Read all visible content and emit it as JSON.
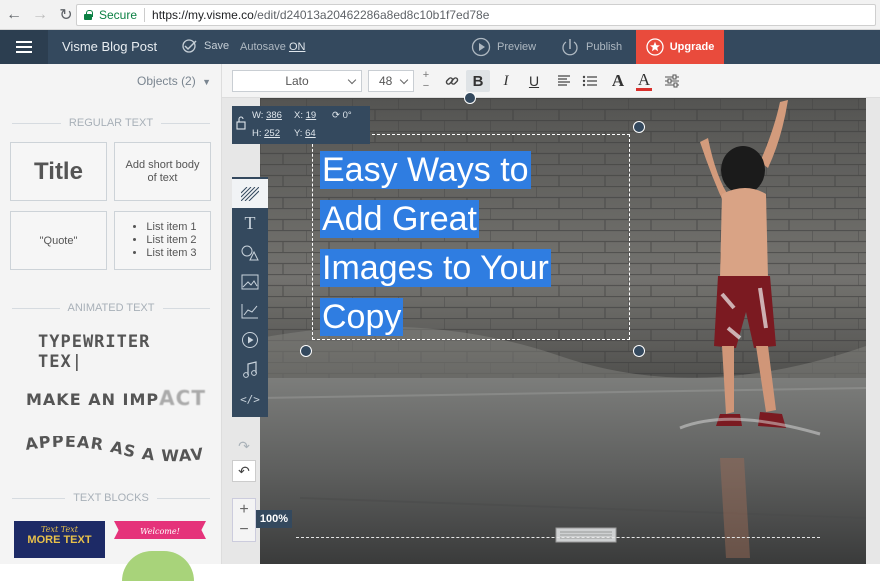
{
  "browser": {
    "secure_label": "Secure",
    "url_host": "https://my.visme.co",
    "url_path": "/edit/d24013a20462286a8ed8c10b1f7ed78e"
  },
  "header": {
    "project_title": "Visme Blog Post",
    "save_label": "Save",
    "autosave_label": "Autosave",
    "autosave_state": "ON",
    "preview_label": "Preview",
    "publish_label": "Publish",
    "upgrade_label": "Upgrade"
  },
  "left_panel": {
    "objects_label": "Objects (2)",
    "regular_text_label": "REGULAR TEXT",
    "tiles": {
      "title": "Title",
      "short_body": "Add short body of text",
      "quote": "\"Quote\"",
      "list_items": [
        "List item 1",
        "List item 2",
        "List item 3"
      ]
    },
    "animated_text_label": "ANIMATED TEXT",
    "animated": {
      "typewriter": "TYPEWRITER TEX",
      "impact": "MAKE AN IMP",
      "impact_tail": "ACT",
      "wave": "APPEAR AS A WAVE"
    },
    "text_blocks_label": "TEXT BLOCKS",
    "blocks": {
      "block1_top": "Text Text",
      "block1_bottom": "MORE TEXT",
      "block2": "Welcome!"
    }
  },
  "toolbar": {
    "font": "Lato",
    "size": "48",
    "plus": "+",
    "minus": "−",
    "bold": "B",
    "italic": "I",
    "underline": "U",
    "font_color": "A",
    "highlight": "A"
  },
  "canvas": {
    "headline_lines": [
      "Easy Ways to",
      "Add Great",
      "Images to Your",
      "Copy"
    ],
    "dims": {
      "w_label": "W:",
      "w": "386",
      "h_label": "H:",
      "h": "252",
      "x_label": "X:",
      "x": "19",
      "y_label": "Y:",
      "y": "64",
      "rotation": "0°"
    },
    "zoom": "100%"
  },
  "colors": {
    "header_bg": "#34495e",
    "accent": "#e94b3c",
    "selection": "#2f7de1"
  }
}
